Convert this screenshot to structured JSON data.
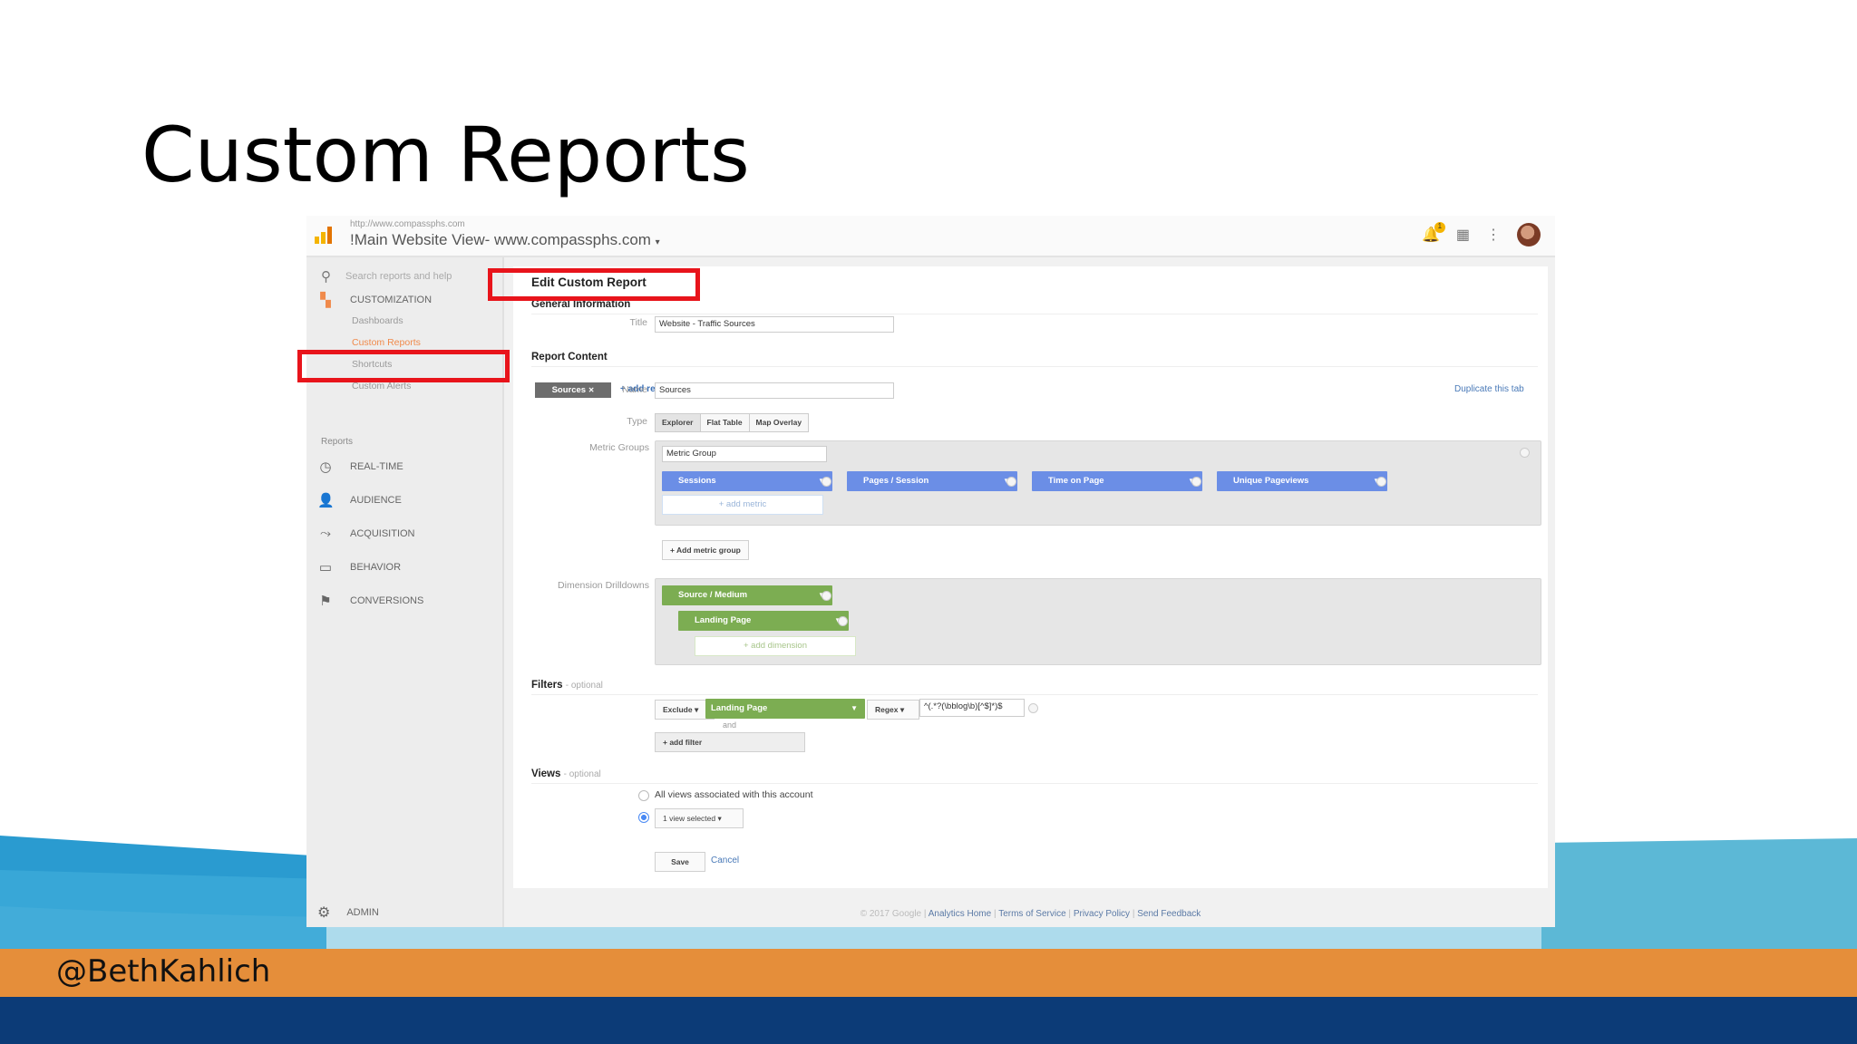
{
  "slide": {
    "title": "Custom Reports",
    "handle": "@BethKahlich",
    "colors": {
      "orange_band": "#e58e3a",
      "navy_band": "#0c3b77",
      "wave_light": "#5cb8d6",
      "wave_dark": "#2a9bd0"
    }
  },
  "ga": {
    "url": "http://www.compassphs.com",
    "view_name": "!Main Website View- www.compassphs.com",
    "notification_count": "1",
    "icons": [
      "bell-icon",
      "apps-grid-icon",
      "more-vert-icon",
      "avatar"
    ],
    "sidebar": {
      "search_placeholder": "Search reports and help",
      "customization_label": "CUSTOMIZATION",
      "customization_items": [
        "Dashboards",
        "Custom Reports",
        "Shortcuts",
        "Custom Alerts"
      ],
      "reports_label": "Reports",
      "reports_items": [
        "REAL-TIME",
        "AUDIENCE",
        "ACQUISITION",
        "BEHAVIOR",
        "CONVERSIONS"
      ],
      "admin_label": "ADMIN"
    },
    "editor": {
      "heading": "Edit Custom Report",
      "general_info": "General Information",
      "title_label": "Title",
      "title_value": "Website - Traffic Sources",
      "report_content": "Report Content",
      "tab_name": "Sources",
      "add_report_tab": "+ add report tab",
      "name_label": "Name",
      "name_value": "Sources",
      "duplicate_tab": "Duplicate this tab",
      "type_label": "Type",
      "types": [
        "Explorer",
        "Flat Table",
        "Map Overlay"
      ],
      "metric_groups_label": "Metric Groups",
      "metric_group_name": "Metric Group",
      "metrics": [
        "Sessions",
        "Pages / Session",
        "Time on Page",
        "Unique Pageviews"
      ],
      "add_metric": "+ add metric",
      "add_metric_group": "+ Add metric group",
      "dimension_label": "Dimension Drilldowns",
      "dimensions": [
        "Source / Medium",
        "Landing Page"
      ],
      "add_dimension": "+ add dimension",
      "filters_label": "Filters",
      "optional": "- optional",
      "filter_mode": "Exclude",
      "filter_dimension": "Landing Page",
      "filter_match": "Regex",
      "filter_value": "^(.*?(\\bblog\\b)[^$]*)$",
      "and_label": "and",
      "add_filter": "+ add filter",
      "views_label": "Views",
      "views_all": "All views associated with this account",
      "views_selected": "1 view selected",
      "save": "Save",
      "cancel": "Cancel"
    },
    "footer": {
      "copyright": "© 2017 Google |",
      "links": [
        "Analytics Home",
        "Terms of Service",
        "Privacy Policy",
        "Send Feedback"
      ]
    }
  }
}
